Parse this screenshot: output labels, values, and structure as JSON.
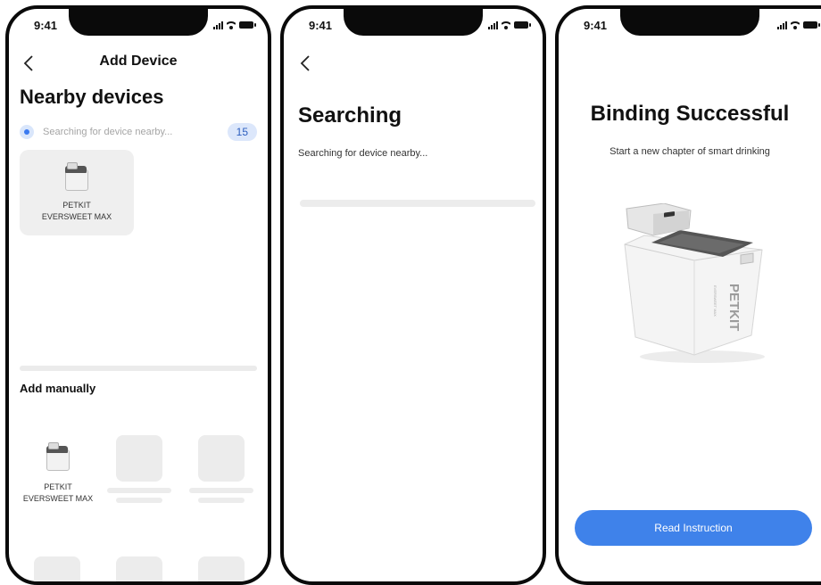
{
  "status_bar": {
    "time": "9:41"
  },
  "screen1": {
    "nav_title": "Add Device",
    "back_icon": "chevron-left-icon",
    "heading": "Nearby devices",
    "searching_text": "Searching for device nearby...",
    "count": "15",
    "device": {
      "line1": "PETKIT",
      "line2": "EVERSWEET MAX"
    },
    "manual_title": "Add manually",
    "manual_device": {
      "line1": "PETKIT",
      "line2": "EVERSWEET MAX"
    }
  },
  "screen2": {
    "back_icon": "chevron-left-icon",
    "heading": "Searching",
    "subtext": "Searching for device nearby..."
  },
  "screen3": {
    "heading": "Binding Successful",
    "subtitle": "Start a new chapter of smart drinking",
    "product_brand": "PETKIT",
    "product_model": "EVERSWEET MAX",
    "button_label": "Read Instruction"
  },
  "colors": {
    "accent": "#3f82ea",
    "badge_bg": "#dce7fb",
    "placeholder": "#ececec",
    "card_bg": "#efefef"
  }
}
